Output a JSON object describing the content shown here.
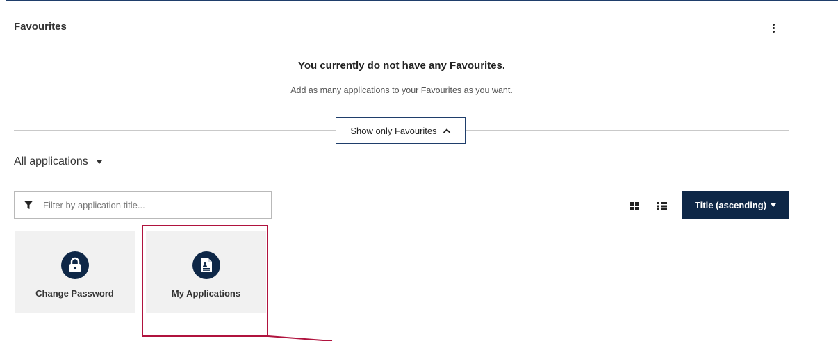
{
  "favourites": {
    "title": "Favourites",
    "empty_heading": "You currently do not have any Favourites.",
    "empty_subtext": "Add as many applications to your Favourites as you want.",
    "toggle_label": "Show only Favourites"
  },
  "applications": {
    "section_label": "All applications",
    "filter_placeholder": "Filter by application title...",
    "filter_value": "",
    "sort_label": "Title (ascending)",
    "tiles": [
      {
        "label": "Change Password",
        "icon": "lock-icon"
      },
      {
        "label": "My Applications",
        "icon": "document-icon"
      }
    ]
  },
  "colors": {
    "primary": "#0e2747",
    "highlight": "#b0133e",
    "tile_background": "#f1f1f1"
  }
}
